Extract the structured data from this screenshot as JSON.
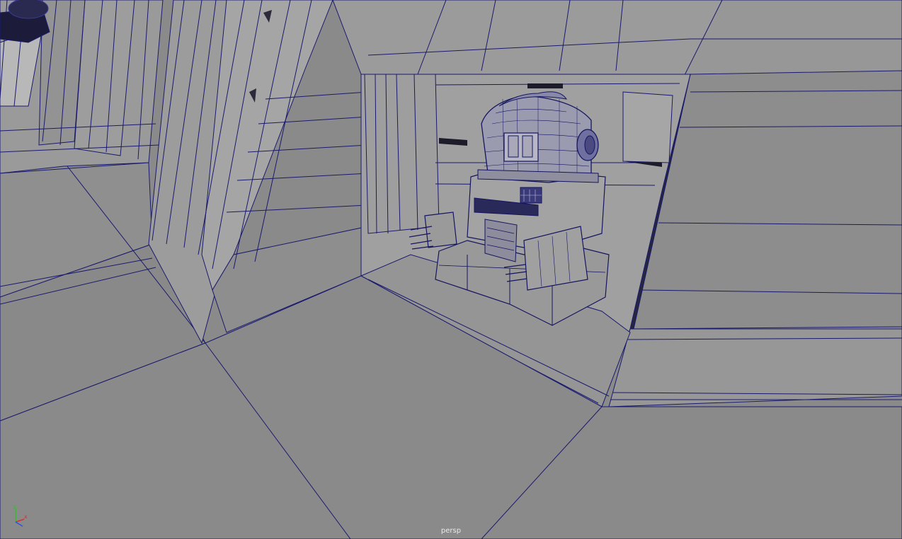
{
  "viewport": {
    "camera_name": "persp",
    "view_mode": "wireframe-on-shaded",
    "wire_color": "#1a1a6e",
    "surface_color": "#8b8b8b"
  },
  "axis_gizmo": {
    "x_label": "x",
    "y_label": "y",
    "x_color": "#d83030",
    "y_color": "#30c030",
    "z_color": "#3050e0"
  },
  "scene": {
    "subject": "robot-in-wall-alcove",
    "icon": "wireframe-robot"
  }
}
